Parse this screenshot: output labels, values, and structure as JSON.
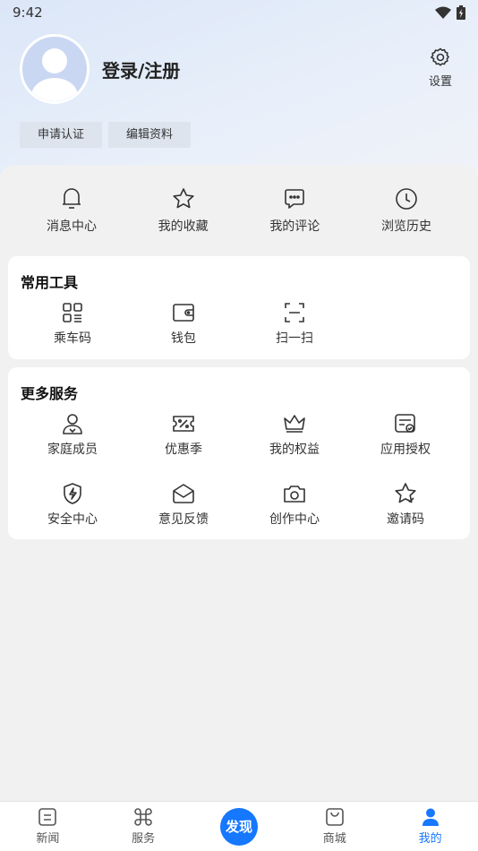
{
  "status_bar": {
    "time": "9:42",
    "wifi_icon": "wifi-icon",
    "battery_icon": "battery-icon"
  },
  "profile": {
    "login_label": "登录/注册",
    "settings_label": "设置"
  },
  "actions": {
    "apply_certification": "申请认证",
    "edit_profile": "编辑资料"
  },
  "quick_links": [
    {
      "label": "消息中心",
      "icon": "bell-icon"
    },
    {
      "label": "我的收藏",
      "icon": "star-icon"
    },
    {
      "label": "我的评论",
      "icon": "comment-icon"
    },
    {
      "label": "浏览历史",
      "icon": "clock-icon"
    }
  ],
  "common_tools": {
    "title": "常用工具",
    "items": [
      {
        "label": "乘车码",
        "icon": "qr-code-icon"
      },
      {
        "label": "钱包",
        "icon": "wallet-icon"
      },
      {
        "label": "扫一扫",
        "icon": "scan-icon"
      }
    ]
  },
  "more_services": {
    "title": "更多服务",
    "items": [
      {
        "label": "家庭成员",
        "icon": "family-icon"
      },
      {
        "label": "优惠季",
        "icon": "coupon-icon"
      },
      {
        "label": "我的权益",
        "icon": "crown-icon"
      },
      {
        "label": "应用授权",
        "icon": "authorization-icon"
      },
      {
        "label": "安全中心",
        "icon": "shield-icon"
      },
      {
        "label": "意见反馈",
        "icon": "envelope-icon"
      },
      {
        "label": "创作中心",
        "icon": "camera-icon"
      },
      {
        "label": "邀请码",
        "icon": "star-outline-icon"
      }
    ]
  },
  "bottom_nav": {
    "news": "新闻",
    "services": "服务",
    "discover": "发现",
    "mall": "商城",
    "mine": "我的",
    "active": "mine"
  },
  "colors": {
    "accent": "#1677ff",
    "header_gradient": "#dbe6f7",
    "page_bg": "#f1f1f1"
  }
}
